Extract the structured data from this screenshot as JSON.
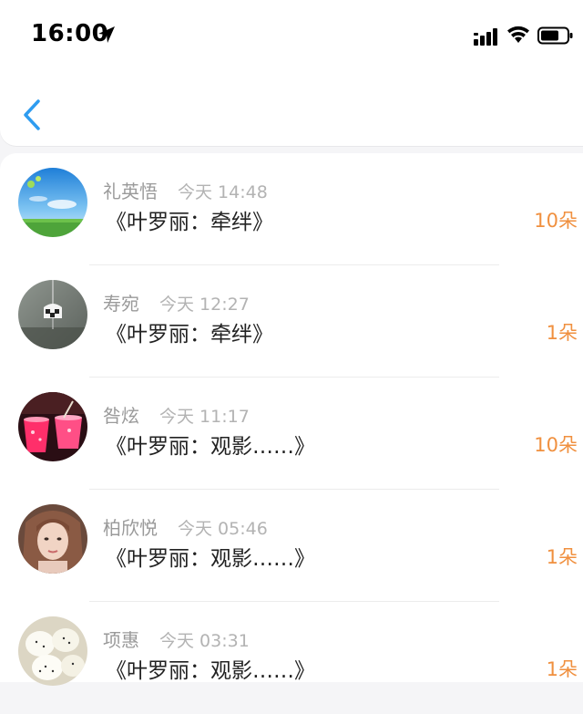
{
  "status_bar": {
    "time": "16:00",
    "icons": [
      "location-arrow-icon",
      "signal-icon",
      "wifi-icon",
      "battery-icon"
    ]
  },
  "nav": {
    "back_icon": "chevron-left-icon"
  },
  "colors": {
    "accent": "#2e9cf0",
    "count": "#f0903f",
    "name": "#9a9a9a",
    "title": "#222222"
  },
  "records": [
    {
      "name": "礼英悟",
      "time": "今天 14:48",
      "title": "《叶罗丽：牵绊》",
      "count": "10朵",
      "avatar": "sky-meadow"
    },
    {
      "name": "寿宛",
      "time": "今天 12:27",
      "title": "《叶罗丽：牵绊》",
      "count": "1朵",
      "avatar": "wind-chime"
    },
    {
      "name": "咎炫",
      "time": "今天 11:17",
      "title": "《叶罗丽：观影……》",
      "count": "10朵",
      "avatar": "pink-drinks"
    },
    {
      "name": "柏欣悦",
      "time": "今天 05:46",
      "title": "《叶罗丽：观影……》",
      "count": "1朵",
      "avatar": "portrait"
    },
    {
      "name": "项惠",
      "time": "今天 03:31",
      "title": "《叶罗丽：观影……》",
      "count": "1朵",
      "avatar": "dumplings"
    }
  ]
}
